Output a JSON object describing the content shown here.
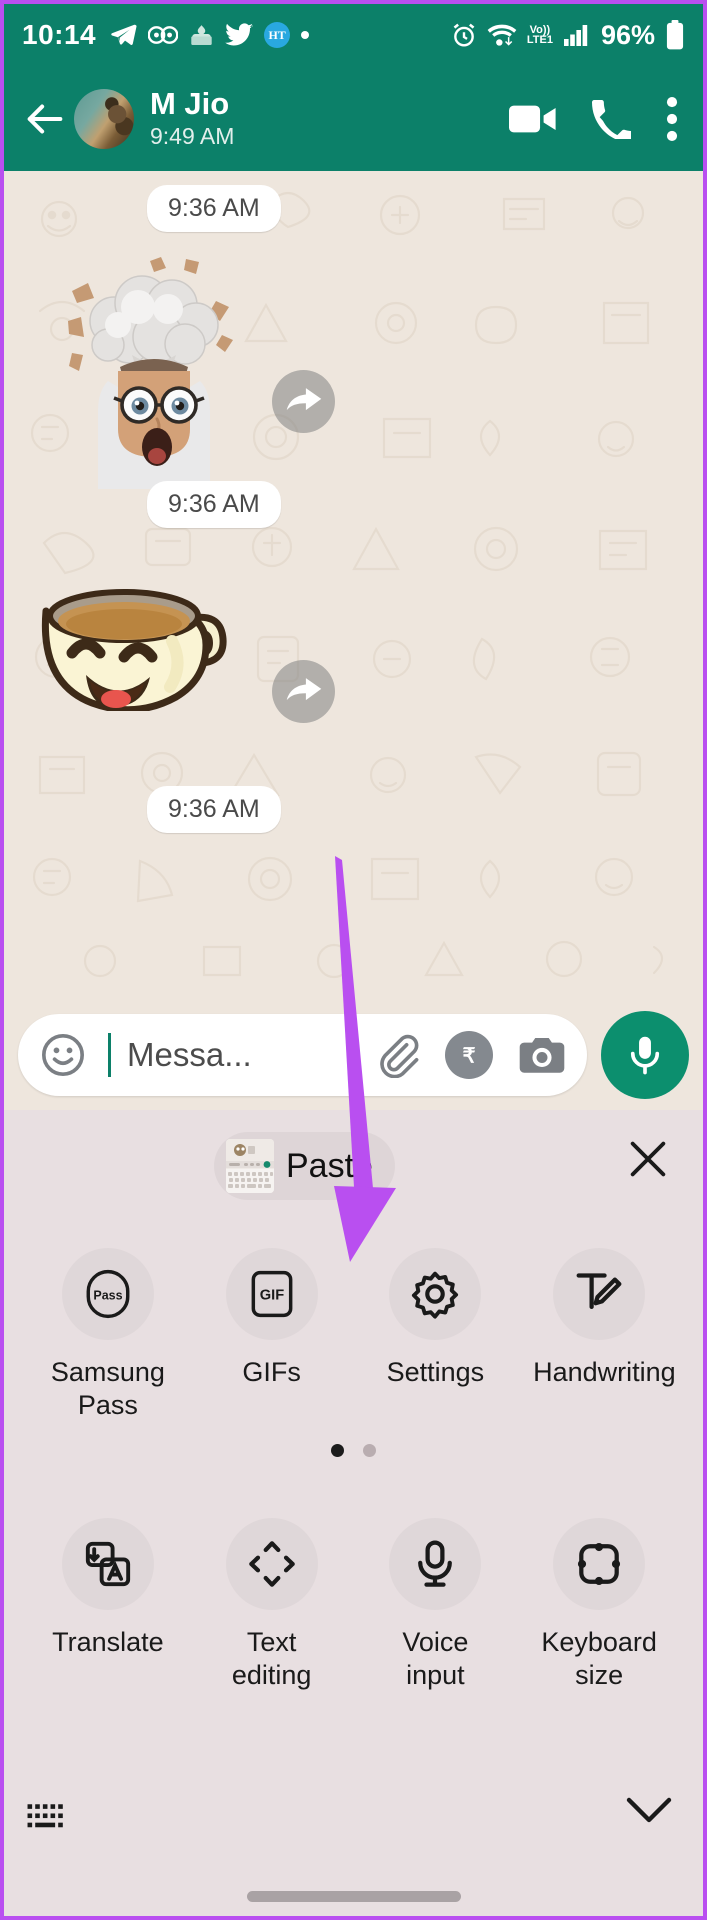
{
  "theme": {
    "header_green": "#0c8069",
    "chat_bg": "#eee6dd",
    "keyboard_bg": "#e8dfe1",
    "accent_purple": "#b94ff0",
    "mic_green": "#0c8f6e",
    "frame_border": "#b94ff0"
  },
  "status_bar": {
    "time": "10:14",
    "left_icons": [
      "telegram-icon",
      "google-voice-icon",
      "mosque-app-icon",
      "twitter-icon",
      "ht-news-icon",
      "notification-dot-icon"
    ],
    "ht_badge_text": "HT",
    "right_icons": [
      "alarm-icon",
      "wifi-icon",
      "volte-icon",
      "signal-bars-icon",
      "battery-icon"
    ],
    "volte_top": "Vo))",
    "volte_bottom": "LTE1",
    "battery_percent": "96%"
  },
  "chat_header": {
    "back_icon": "arrow-left-icon",
    "contact_name": "M Jio",
    "contact_status": "9:49 AM",
    "actions": [
      "video-call-icon",
      "voice-call-icon",
      "more-options-icon"
    ]
  },
  "chat": {
    "messages": [
      {
        "type": "time",
        "time": "9:36 AM"
      },
      {
        "type": "sticker",
        "name": "mind-blown-memoji-sticker",
        "time": "9:36 AM",
        "forward": "forward-icon"
      },
      {
        "type": "sticker",
        "name": "happy-coffee-cup-sticker",
        "time": "9:36 AM",
        "forward": "forward-icon"
      }
    ],
    "timestamps": [
      "9:36 AM",
      "9:36 AM",
      "9:36 AM"
    ]
  },
  "input_bar": {
    "emoji_icon": "emoji-icon",
    "placeholder": "Messa...",
    "value": "",
    "attach_icon": "attachment-icon",
    "payment_icon": "rupee-payment-icon",
    "camera_icon": "camera-icon",
    "mic_icon": "microphone-icon"
  },
  "keyboard_panel": {
    "paste": {
      "label": "Paste",
      "thumbnail": "clipboard-screenshot-thumbnail"
    },
    "close_icon": "close-icon",
    "rows": [
      [
        {
          "label": "Samsung Pass",
          "icon": "samsung-pass-icon",
          "icon_text": "Pass"
        },
        {
          "label": "GIFs",
          "icon": "gif-icon",
          "icon_text": "GIF"
        },
        {
          "label": "Settings",
          "icon": "gear-icon",
          "icon_text": ""
        },
        {
          "label": "Handwriting",
          "icon": "handwriting-icon",
          "icon_text": ""
        }
      ],
      [
        {
          "label": "Translate",
          "icon": "translate-icon",
          "icon_text": ""
        },
        {
          "label": "Text editing",
          "icon": "text-editing-icon",
          "icon_text": ""
        },
        {
          "label": "Voice input",
          "icon": "voice-input-icon",
          "icon_text": ""
        },
        {
          "label": "Keyboard size",
          "icon": "keyboard-size-icon",
          "icon_text": ""
        }
      ]
    ],
    "page_dots": {
      "total": 2,
      "active": 1
    },
    "footer": {
      "keyboard_icon": "keyboard-icon",
      "collapse_icon": "chevron-down-icon"
    }
  },
  "annotation": {
    "type": "arrow",
    "color": "#b94ff0",
    "points_to": "Settings"
  }
}
